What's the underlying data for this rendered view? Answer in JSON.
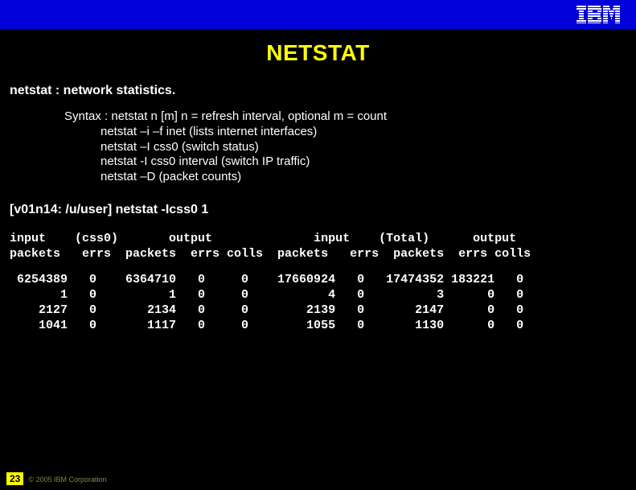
{
  "title": "NETSTAT",
  "intro": "netstat : network statistics.",
  "syntax": {
    "main": "Syntax : netstat n [m] n = refresh interval, optional m = count",
    "lines": [
      "netstat –i –f inet (lists internet interfaces)",
      "netstat –I css0 (switch status)",
      "netstat -I css0 interval (switch IP traffic)",
      "netstat –D (packet counts)"
    ]
  },
  "command": "[v01n14: /u/user] netstat -Icss0 1",
  "table": {
    "header1": "input    (css0)       output              input    (Total)      output",
    "header2": "packets   errs  packets  errs colls  packets   errs  packets  errs colls",
    "rows": [
      " 6254389   0    6364710   0     0    17660924   0   17474352 183221   0",
      "       1   0          1   0     0           4   0          3      0   0",
      "    2127   0       2134   0     0        2139   0       2147      0   0",
      "    1041   0       1117   0     0        1055   0       1130      0   0"
    ]
  },
  "footer": {
    "page": "23",
    "copyright": "© 2005 IBM Corporation"
  },
  "logo_name": "ibm-logo"
}
